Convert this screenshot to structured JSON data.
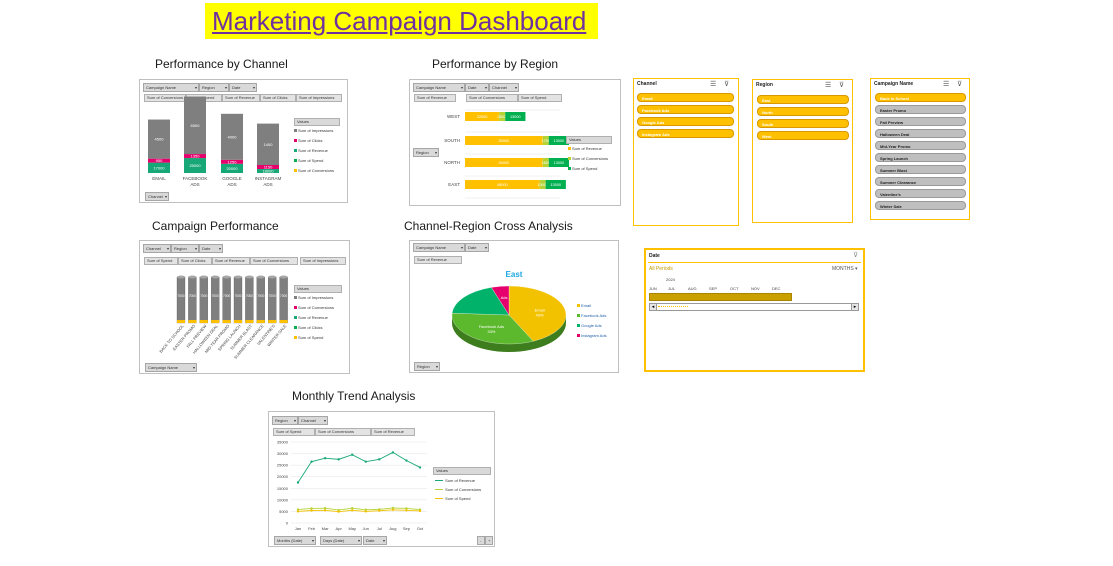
{
  "dashboard_title": "Marketing Campaign Dashboard",
  "colors": {
    "yellow": "#ffff00",
    "purple": "#7030a0",
    "gold": "#ffc000",
    "gray_bar": "#7f7f7f",
    "pink": "#e6006e",
    "green": "#00b050",
    "teal": "#18a878",
    "amber": "#ffc000"
  },
  "sections": {
    "channel": "Performance by Channel",
    "region": "Performance by Region",
    "campaign": "Campaign Performance",
    "cross": "Channel-Region Cross Analysis",
    "monthly": "Monthly Trend Analysis"
  },
  "channel_panel": {
    "filters": [
      "Campaign Name",
      "Region",
      "Date"
    ],
    "fields": [
      "Sum of Conversions",
      "Sum of Spend",
      "Sum of Revenue",
      "Sum of Clicks",
      "Sum of Impressions"
    ],
    "axis_field": "Channel",
    "legend_title": "Values",
    "legend": [
      "Sum of Impressions",
      "Sum of Clicks",
      "Sum of Revenue",
      "Sum of Spend",
      "Sum of Conversions"
    ]
  },
  "region_panel": {
    "filters": [
      "Campaign Name",
      "Date",
      "Channel"
    ],
    "fields": [
      "Sum of Revenue",
      "Sum of Conversions",
      "Sum of Spend"
    ],
    "axis_field": "Region",
    "legend_title": "Values",
    "legend": [
      "Sum of Revenue",
      "Sum of Conversions",
      "Sum of Spend"
    ]
  },
  "campaign_panel": {
    "filters": [
      "Channel",
      "Region",
      "Date"
    ],
    "fields": [
      "Sum of Spend",
      "Sum of Clicks",
      "Sum of Revenue",
      "Sum of Conversions",
      "Sum of Impressions"
    ],
    "axis_field": "Campaign Name",
    "legend_title": "Values",
    "legend": [
      "Sum of Impressions",
      "Sum of Conversions",
      "Sum of Revenue",
      "Sum of Clicks",
      "Sum of Spend"
    ]
  },
  "cross_panel": {
    "filters": [
      "Campaign Name",
      "Date"
    ],
    "fields": [
      "Sum of Revenue"
    ],
    "axis_field": "Region",
    "legend": [
      "Email",
      "Facebook Ads",
      "Google Ads",
      "Instagram Ads"
    ]
  },
  "monthly_panel": {
    "filters": [
      "Region",
      "Channel"
    ],
    "fields": [
      "Sum of Spend",
      "Sum of Conversions",
      "Sum of Revenue"
    ],
    "axis_fields": [
      "Months (Date)",
      "Days (Date)",
      "Date"
    ],
    "legend_title": "Values",
    "legend": [
      "Sum of Revenue",
      "Sum of Conversions",
      "Sum of Spend"
    ]
  },
  "slicers": {
    "channel": {
      "title": "Channel",
      "items": [
        "Email",
        "Facebook Ads",
        "Google Ads",
        "Instagram Ads"
      ]
    },
    "region": {
      "title": "Region",
      "items": [
        "East",
        "North",
        "South",
        "West"
      ]
    },
    "campaign": {
      "title": "Campaign Name",
      "items": [
        "Back to School",
        "Easter Promo",
        "Fall Preview",
        "Halloween Deal",
        "Mid-Year Promo",
        "Spring Launch",
        "Summer Blast",
        "Summer Clearance",
        "Valentine's",
        "Winter Sale"
      ]
    }
  },
  "timeline": {
    "title": "Date",
    "periods_label": "All Periods",
    "level": "MONTHS",
    "year": "2024",
    "months": [
      "JUN",
      "JUL",
      "AUG",
      "SEP",
      "OCT",
      "NOV",
      "DEC"
    ]
  },
  "chart_data": [
    {
      "type": "bar",
      "name": "Performance by Channel",
      "categories": [
        "EMAIL",
        "FACEBOOK ADS",
        "GOOGLE ADS",
        "INSTAGRAM ADS"
      ],
      "series": [
        {
          "name": "Sum of Impressions",
          "values": [
            17000,
            25000,
            20000,
            18000
          ]
        },
        {
          "name": "Sum of Clicks",
          "values": [
            950,
            1350,
            1250,
            1150
          ]
        },
        {
          "name": "Sum of Revenue",
          "values": [
            4500,
            6500,
            4000,
            1400
          ]
        },
        {
          "name": "Sum of Spend",
          "values": [
            0,
            0,
            0,
            0
          ]
        },
        {
          "name": "Sum of Conversions",
          "values": [
            0,
            0,
            0,
            0
          ]
        }
      ],
      "data_labels": [
        [
          "17000",
          "950",
          "4500"
        ],
        [
          "25000",
          "1350",
          "6500"
        ],
        [
          "20000",
          "1250",
          "4000"
        ],
        [
          "18000",
          "1150",
          "1400"
        ]
      ]
    },
    {
      "type": "bar",
      "name": "Performance by Region",
      "orientation": "horizontal",
      "categories": [
        "WEST",
        "SOUTH",
        "NORTH",
        "EAST"
      ],
      "series": [
        {
          "name": "Sum of Revenue",
          "values": [
            22000,
            50000,
            50000,
            48000
          ]
        },
        {
          "name": "Sum of Conversions",
          "values": [
            1300,
            1750,
            1600,
            1900
          ]
        },
        {
          "name": "Sum of Spend",
          "values": [
            13000,
            13000,
            13000,
            13000
          ]
        }
      ],
      "data_labels": [
        [
          "22000",
          "13000",
          "13000"
        ],
        [
          "50000",
          "1750",
          "13000"
        ],
        [
          "50000",
          "1600",
          "13000"
        ],
        [
          "48000",
          "13000",
          "13000"
        ]
      ]
    },
    {
      "type": "bar",
      "name": "Campaign Performance",
      "categories": [
        "BACK TO SCHOOL",
        "EASTER PROMO",
        "FALL PREVIEW",
        "HALLOWEEN DEAL",
        "MID-YEAR PROMO",
        "SPRING LAUNCH",
        "SUMMER BLAST",
        "SUMMER CLEARANCE",
        "VALENTINE'S",
        "WINTER SALE"
      ],
      "series": [
        {
          "name": "Sum of Impressions",
          "values": [
            7000,
            7000,
            7000,
            7000,
            7000,
            7000,
            7000,
            7000,
            7000,
            7000
          ]
        },
        {
          "name": "Sum of Spend",
          "values": [
            600,
            600,
            600,
            600,
            600,
            600,
            600,
            600,
            600,
            600
          ]
        }
      ],
      "data_labels": [
        "7000",
        "7000",
        "7000",
        "7000",
        "7000",
        "7000",
        "7000",
        "7000",
        "7000",
        "7000"
      ]
    },
    {
      "type": "pie",
      "name": "Channel-Region Cross Analysis",
      "title": "East",
      "labels": [
        "Email",
        "Facebook Ads",
        "Google Ads",
        "Instagram Ads"
      ],
      "values": [
        43,
        33,
        19,
        5
      ],
      "slice_labels": [
        "Email 43%",
        "Facebook Ads 33%",
        "",
        "Ads"
      ],
      "colors": [
        "#f2c200",
        "#5cb82c",
        "#00b26a",
        "#e6006e"
      ]
    },
    {
      "type": "line",
      "name": "Monthly Trend Analysis",
      "x": [
        "Jan",
        "Feb",
        "Mar",
        "Apr",
        "May",
        "Jun",
        "Jul",
        "Aug",
        "Sep",
        "Oct"
      ],
      "series": [
        {
          "name": "Sum of Revenue",
          "values": [
            17500,
            26500,
            28000,
            27500,
            29500,
            26500,
            27500,
            30500,
            27000,
            24000
          ]
        },
        {
          "name": "Sum of Conversions",
          "values": [
            5800,
            6300,
            6400,
            5600,
            6400,
            5700,
            5900,
            6500,
            6300,
            5800
          ]
        },
        {
          "name": "Sum of Spend",
          "values": [
            5000,
            5400,
            5500,
            4900,
            5500,
            5000,
            5300,
            5700,
            5500,
            5200
          ]
        }
      ],
      "yticks": [
        "35000",
        "30000",
        "25000",
        "20000",
        "15000",
        "10000",
        "5000",
        "0"
      ],
      "ylim": [
        0,
        35000
      ]
    }
  ]
}
